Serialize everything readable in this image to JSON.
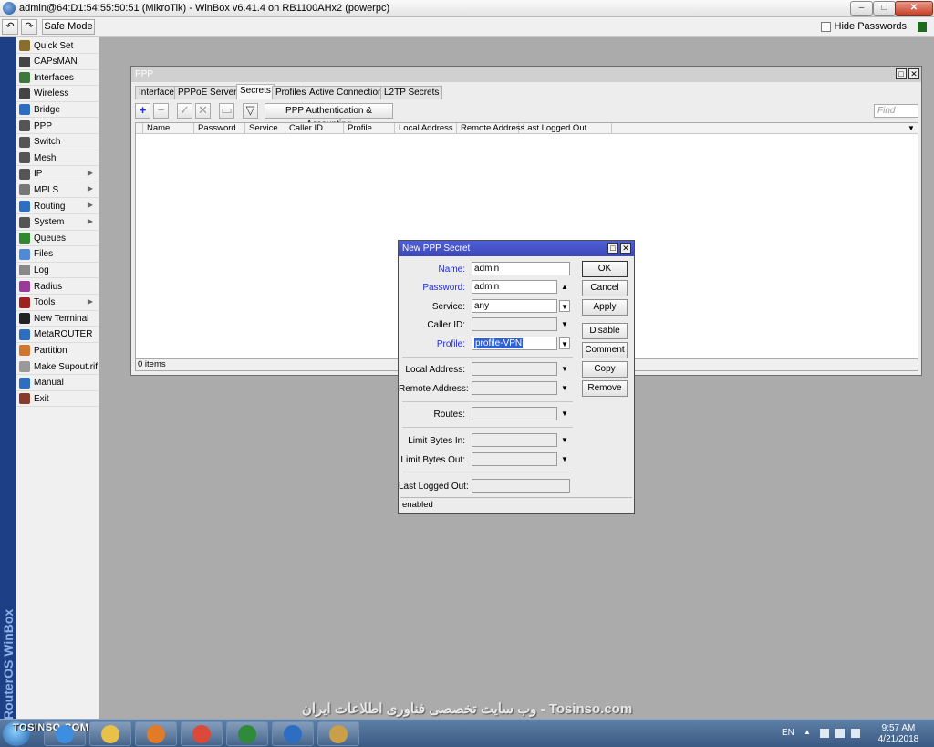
{
  "window": {
    "title": "admin@64:D1:54:55:50:51 (MikroTik) - WinBox v6.41.4 on RB1100AHx2 (powerpc)",
    "min": "–",
    "max": "□",
    "close": "✕"
  },
  "toolbar": {
    "undo": "↶",
    "redo": "↷",
    "safe_mode": "Safe Mode",
    "hide_passwords": "Hide Passwords"
  },
  "sidebar": {
    "brand_vertical": "RouterOS WinBox",
    "items": [
      {
        "label": "Quick Set",
        "icon": "wand-icon",
        "color": "#8a6d2a"
      },
      {
        "label": "CAPsMAN",
        "icon": "antenna-icon",
        "color": "#444444"
      },
      {
        "label": "Interfaces",
        "icon": "interfaces-icon",
        "color": "#3b7a3b"
      },
      {
        "label": "Wireless",
        "icon": "wireless-icon",
        "color": "#444444"
      },
      {
        "label": "Bridge",
        "icon": "bridge-icon",
        "color": "#2e6ec2"
      },
      {
        "label": "PPP",
        "icon": "ppp-icon",
        "color": "#555555"
      },
      {
        "label": "Switch",
        "icon": "switch-icon",
        "color": "#555555"
      },
      {
        "label": "Mesh",
        "icon": "mesh-icon",
        "color": "#555555"
      },
      {
        "label": "IP",
        "icon": "ip-icon",
        "color": "#555555",
        "arrow": true
      },
      {
        "label": "MPLS",
        "icon": "mpls-icon",
        "color": "#777777",
        "arrow": true
      },
      {
        "label": "Routing",
        "icon": "routing-icon",
        "color": "#2e6ec2",
        "arrow": true
      },
      {
        "label": "System",
        "icon": "gear-icon",
        "color": "#555555",
        "arrow": true
      },
      {
        "label": "Queues",
        "icon": "queues-icon",
        "color": "#2f8a2f"
      },
      {
        "label": "Files",
        "icon": "folder-icon",
        "color": "#4f8ad9"
      },
      {
        "label": "Log",
        "icon": "log-icon",
        "color": "#888888"
      },
      {
        "label": "Radius",
        "icon": "radius-icon",
        "color": "#9b3a9b"
      },
      {
        "label": "Tools",
        "icon": "tools-icon",
        "color": "#a02020",
        "arrow": true
      },
      {
        "label": "New Terminal",
        "icon": "terminal-icon",
        "color": "#222222"
      },
      {
        "label": "MetaROUTER",
        "icon": "metarouter-icon",
        "color": "#2e6ec2"
      },
      {
        "label": "Partition",
        "icon": "partition-icon",
        "color": "#d0762a"
      },
      {
        "label": "Make Supout.rif",
        "icon": "supout-icon",
        "color": "#999999"
      },
      {
        "label": "Manual",
        "icon": "help-icon",
        "color": "#2e6ec2"
      },
      {
        "label": "Exit",
        "icon": "exit-icon",
        "color": "#8a3a2a"
      }
    ]
  },
  "ppp": {
    "title": "PPP",
    "tabs": [
      "Interface",
      "PPPoE Servers",
      "Secrets",
      "Profiles",
      "Active Connections",
      "L2TP Secrets"
    ],
    "active_tab": "Secrets",
    "tools": {
      "add": "+",
      "remove": "−",
      "enable": "✓",
      "disable": "✕",
      "comment": "▭",
      "filter": "▽",
      "auth_button": "PPP Authentication & Accounting",
      "find_placeholder": "Find"
    },
    "columns": [
      "Name",
      "Password",
      "Service",
      "Caller ID",
      "Profile",
      "Local Address",
      "Remote Address",
      "Last Logged Out"
    ],
    "status": "0 items"
  },
  "dialog": {
    "title": "New PPP Secret",
    "fields": {
      "name": {
        "label": "Name:",
        "value": "admin"
      },
      "password": {
        "label": "Password:",
        "value": "admin"
      },
      "service": {
        "label": "Service:",
        "value": "any"
      },
      "caller_id": {
        "label": "Caller ID:",
        "value": ""
      },
      "profile": {
        "label": "Profile:",
        "value": "profile-VPN"
      },
      "local_address": {
        "label": "Local Address:",
        "value": ""
      },
      "remote_address": {
        "label": "Remote Address:",
        "value": ""
      },
      "routes": {
        "label": "Routes:",
        "value": ""
      },
      "limit_in": {
        "label": "Limit Bytes In:",
        "value": ""
      },
      "limit_out": {
        "label": "Limit Bytes Out:",
        "value": ""
      },
      "last_logged_out": {
        "label": "Last Logged Out:",
        "value": ""
      }
    },
    "buttons": {
      "ok": "OK",
      "cancel": "Cancel",
      "apply": "Apply",
      "disable": "Disable",
      "comment": "Comment",
      "copy": "Copy",
      "remove": "Remove"
    },
    "status": "enabled"
  },
  "watermark": "وب سایت تخصصی فناوری اطلاعات ایران - Tosinso.com",
  "taskbar": {
    "brand": "TOSINSO.COM",
    "apps": [
      {
        "name": "ie-icon",
        "color": "#3d8ee0"
      },
      {
        "name": "explorer-icon",
        "color": "#e8c14a"
      },
      {
        "name": "media-player-icon",
        "color": "#e07b28"
      },
      {
        "name": "chrome-icon",
        "color": "#d94a3a"
      },
      {
        "name": "excel-icon",
        "color": "#2f8a3a"
      },
      {
        "name": "winbox-icon",
        "color": "#2e6ec2"
      },
      {
        "name": "paint-icon",
        "color": "#c9a04a"
      }
    ],
    "lang": "EN",
    "time": "9:57 AM",
    "date": "4/21/2018"
  }
}
